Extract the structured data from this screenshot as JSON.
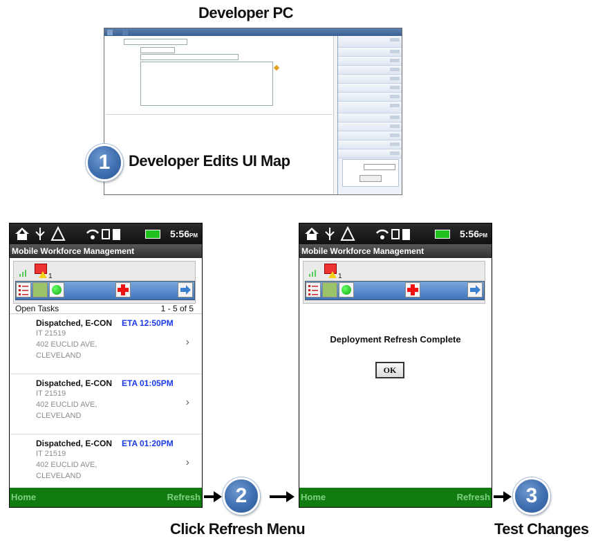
{
  "header": {
    "title": "Developer PC"
  },
  "step1": {
    "number": "1",
    "caption": "Developer Edits UI Map"
  },
  "step2": {
    "number": "2",
    "caption": "Click Refresh Menu"
  },
  "step3": {
    "number": "3",
    "caption": "Test Changes"
  },
  "phone": {
    "clock": "5:56",
    "clock_suffix": "PM",
    "app_title": "Mobile Workforce Management",
    "home_label": "Home",
    "refresh_label": "Refresh",
    "badge_count": "1"
  },
  "tasks_screen": {
    "header_label": "Open Tasks",
    "range": "1 - 5 of 5",
    "items": [
      {
        "status": "Dispatched, E-CON",
        "eta": "ETA 12:50PM",
        "id": "IT 21519",
        "address": "402 EUCLID AVE,",
        "city": "CLEVELAND"
      },
      {
        "status": "Dispatched, E-CON",
        "eta": "ETA 01:05PM",
        "id": "IT 21519",
        "address": "402 EUCLID AVE,",
        "city": "CLEVELAND"
      },
      {
        "status": "Dispatched, E-CON",
        "eta": "ETA 01:20PM",
        "id": "IT 21519",
        "address": "402 EUCLID AVE,",
        "city": "CLEVELAND"
      }
    ]
  },
  "refresh_screen": {
    "message": "Deployment Refresh Complete",
    "ok_label": "OK"
  },
  "colors": {
    "step_circle": "#3f6fb0",
    "bottom_bar": "#117a11",
    "eta_text": "#1a3ae8",
    "app_bar": "#2f2f2f"
  }
}
